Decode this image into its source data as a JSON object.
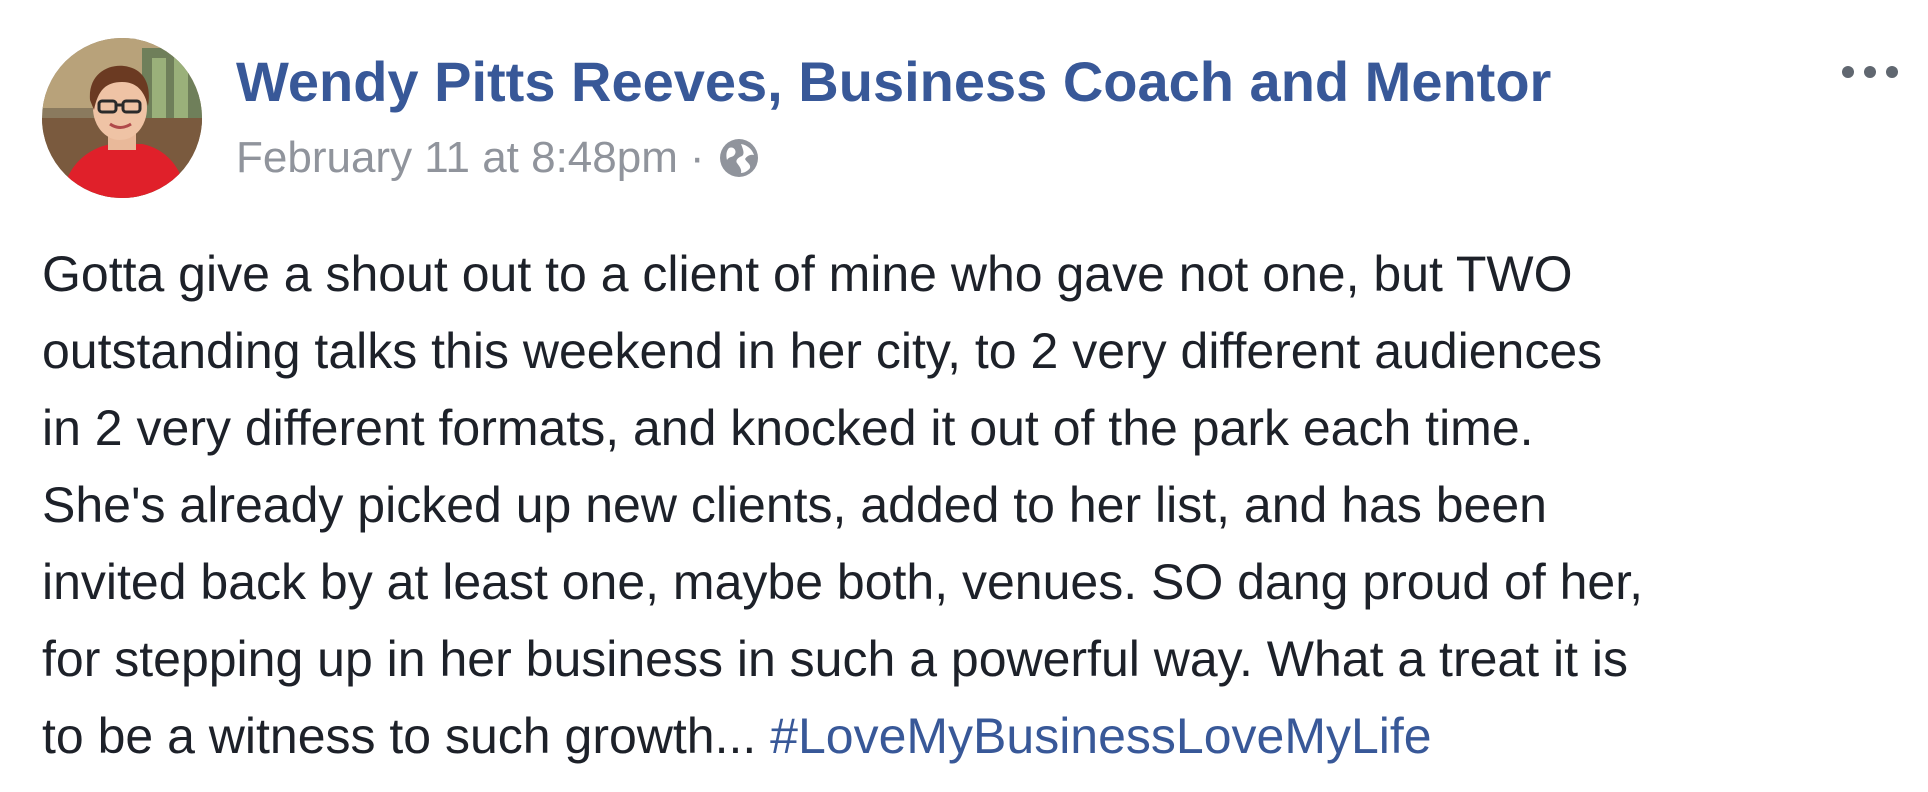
{
  "post": {
    "author": {
      "name": "Wendy Pitts Reeves, Business Coach and Mentor",
      "avatar_icon": "profile-photo"
    },
    "meta": {
      "timestamp": "February 11 at 8:48pm",
      "separator": "·",
      "audience_icon": "globe-icon"
    },
    "menu_icon": "ellipsis-icon",
    "body": {
      "lines": [
        "Gotta give a shout out to a client of mine who gave not one, but TWO",
        "outstanding talks this weekend in her city, to 2 very different audiences",
        "in 2 very different formats, and knocked it out of the park each time.",
        "She's already picked up new clients, added to her list, and has been",
        "invited back by at least one, maybe both, venues. SO dang proud of her,",
        "for stepping up in her business in such a powerful way. What a treat it is",
        "to be a witness to such growth... "
      ],
      "hashtag": "#LoveMyBusinessLoveMyLife"
    },
    "colors": {
      "link": "#385898",
      "meta": "#90949c",
      "text": "#1d2129"
    }
  }
}
